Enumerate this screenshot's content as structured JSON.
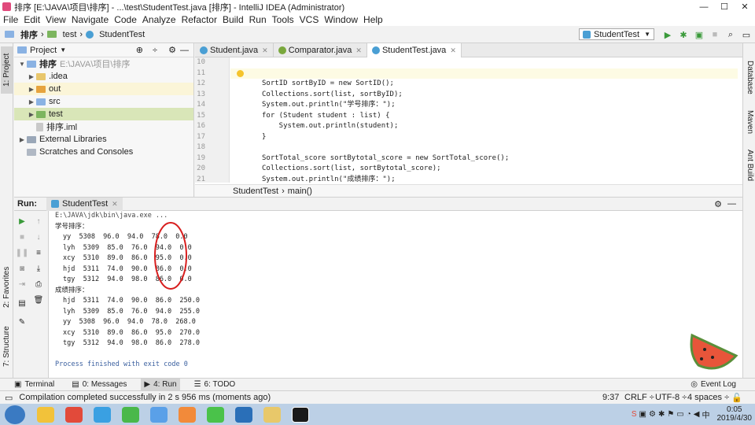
{
  "window": {
    "title": "排序 [E:\\JAVA\\项目\\排序] - ...\\test\\StudentTest.java [排序] - IntelliJ IDEA (Administrator)",
    "minimize": "—",
    "maximize": "☐",
    "close": "✕"
  },
  "menu": [
    "File",
    "Edit",
    "View",
    "Navigate",
    "Code",
    "Analyze",
    "Refactor",
    "Build",
    "Run",
    "Tools",
    "VCS",
    "Window",
    "Help"
  ],
  "navbar": {
    "crumbs": [
      "排序",
      "test",
      "StudentTest"
    ],
    "run_config": "StudentTest"
  },
  "left_tool_tabs": {
    "project": "1: Project",
    "favorites": "2: Favorites",
    "structure": "7: Structure"
  },
  "right_tool_tabs": {
    "database": "Database",
    "maven": "Maven",
    "ant": "Ant Build"
  },
  "project": {
    "header": "Project",
    "root": "排序",
    "root_path": "E:\\JAVA\\项目\\排序",
    "items": [
      ".idea",
      "out",
      "src",
      "test",
      "排序.iml"
    ],
    "external": "External Libraries",
    "scratches": "Scratches and Consoles"
  },
  "editor": {
    "tabs": [
      "Student.java",
      "Comparator.java",
      "StudentTest.java"
    ],
    "active_tab": "StudentTest.java",
    "line_numbers": [
      "10",
      "11",
      "12",
      "13",
      "14",
      "15",
      "16",
      "17",
      "18",
      "19",
      "20",
      "21"
    ],
    "lines": [
      "",
      "",
      "SortID sortByID = new SortID();",
      "Collections.sort(list, sortByID);",
      "System.out.println(\"学号排序：\");",
      "for (Student student : list) {",
      "    System.out.println(student);",
      "}",
      "",
      "SortTotal_score sortBytotal_score = new SortTotal_score();",
      "Collections.sort(list, sortBytotal_score);",
      "System.out.println(\"成绩排序：\");"
    ],
    "breadcrumb": [
      "StudentTest",
      "main()"
    ]
  },
  "run": {
    "label": "Run:",
    "tab": "StudentTest",
    "command": "E:\\JAVA\\jdk\\bin\\java.exe ...",
    "heading1": "学号排序：",
    "rows1": [
      "yy  5308  96.0  94.0  78.0  0.0",
      "lyh  5309  85.0  76.0  94.0  0.0",
      "xcy  5310  89.0  86.0  95.0  0.0",
      "hjd  5311  74.0  90.0  86.0  0.0",
      "tgy  5312  94.0  98.0  86.0  0.0"
    ],
    "heading2": "成绩排序：",
    "rows2": [
      "hjd  5311  74.0  90.0  86.0  250.0",
      "lyh  5309  85.0  76.0  94.0  255.0",
      "yy  5308  96.0  94.0  78.0  268.0",
      "xcy  5310  89.0  86.0  95.0  270.0",
      "tgy  5312  94.0  98.0  86.0  278.0"
    ],
    "finish": "Process finished with exit code 0"
  },
  "bottom_tabs": {
    "terminal": "Terminal",
    "messages": "0: Messages",
    "run": "4: Run",
    "todo": "6: TODO",
    "event_log": "Event Log"
  },
  "status": {
    "message": "Compilation completed successfully in 2 s 956 ms (moments ago)",
    "position": "9:37",
    "line_sep": "CRLF ÷",
    "encoding": "UTF-8 ÷",
    "indent": "4 spaces ÷"
  },
  "taskbar": {
    "time": "0:05",
    "date": "2019/4/30"
  }
}
